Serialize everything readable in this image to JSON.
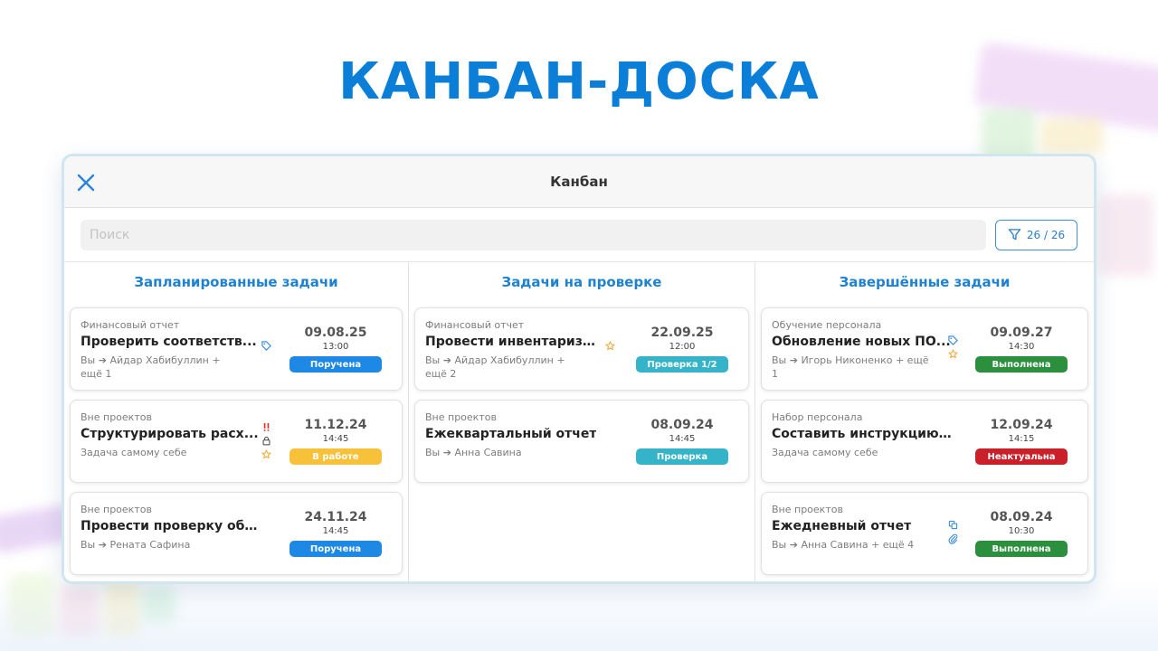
{
  "hero": {
    "title": "КАНБАН-ДОСКА"
  },
  "window": {
    "title": "Канбан"
  },
  "search": {
    "placeholder": "Поиск",
    "value": ""
  },
  "filter": {
    "count": "26 / 26"
  },
  "colors": {
    "accent": "#1f82d0",
    "badge_blue": "#1e88e5",
    "badge_teal": "#35b3c9",
    "badge_yellow": "#f7c23a",
    "badge_green": "#2b8f3e",
    "badge_red": "#c9202a"
  },
  "columns": [
    {
      "title": "Запланированные задачи",
      "cards": [
        {
          "category": "Финансовый отчет",
          "title": "Проверить соответств...",
          "assignee_line1": "Вы  ➔  Айдар Хабибуллин +",
          "assignee_line2": "ещё 1",
          "date": "09.08.25",
          "time": "13:00",
          "status": "Поручена",
          "status_color": "#1e88e5",
          "icons": [
            "tag-icon"
          ]
        },
        {
          "category": "Вне проектов",
          "title": "Структурировать расх...",
          "assignee_line1": "Задача самому себе",
          "assignee_line2": "",
          "date": "11.12.24",
          "time": "14:45",
          "status": "В работе",
          "status_color": "#f7c23a",
          "icons": [
            "exclamation-icon",
            "lock-icon",
            "star-icon"
          ]
        },
        {
          "category": "Вне проектов",
          "title": "Провести проверку обор...",
          "assignee_line1": "Вы  ➔  Рената Сафина",
          "assignee_line2": "",
          "date": "24.11.24",
          "time": "14:45",
          "status": "Поручена",
          "status_color": "#1e88e5",
          "icons": []
        }
      ]
    },
    {
      "title": "Задачи на проверке",
      "cards": [
        {
          "category": "Финансовый отчет",
          "title": "Провести инвентариза...",
          "assignee_line1": "Вы  ➔  Айдар Хабибуллин +",
          "assignee_line2": "ещё 2",
          "date": "22.09.25",
          "time": "12:00",
          "status": "Проверка 1/2",
          "status_color": "#35b3c9",
          "icons": [
            "star-icon"
          ]
        },
        {
          "category": "Вне проектов",
          "title": "Ежеквартальный отчет",
          "assignee_line1": "Вы  ➔  Анна Савина",
          "assignee_line2": "",
          "date": "08.09.24",
          "time": "14:45",
          "status": "Проверка",
          "status_color": "#35b3c9",
          "icons": []
        }
      ]
    },
    {
      "title": "Завершённые задачи",
      "cards": [
        {
          "category": "Обучение персонала",
          "title": "Обновление новых ПО...",
          "assignee_line1": "Вы  ➔  Игорь Никоненко + ещё",
          "assignee_line2": "1",
          "date": "09.09.27",
          "time": "14:30",
          "status": "Выполнена",
          "status_color": "#2b8f3e",
          "icons": [
            "tag-icon",
            "star-icon"
          ]
        },
        {
          "category": "Набор персонала",
          "title": "Составить инструкцию - ...",
          "assignee_line1": "Задача самому себе",
          "assignee_line2": "",
          "date": "12.09.24",
          "time": "14:15",
          "status": "Неактуальна",
          "status_color": "#c9202a",
          "icons": []
        },
        {
          "category": "Вне проектов",
          "title": "Ежедневный отчет",
          "assignee_line1": "Вы  ➔  Анна Савина + ещё 4",
          "assignee_line2": "",
          "date": "08.09.24",
          "time": "10:30",
          "status": "Выполнена",
          "status_color": "#2b8f3e",
          "icons": [
            "copy-icon",
            "paperclip-icon"
          ]
        }
      ]
    }
  ]
}
